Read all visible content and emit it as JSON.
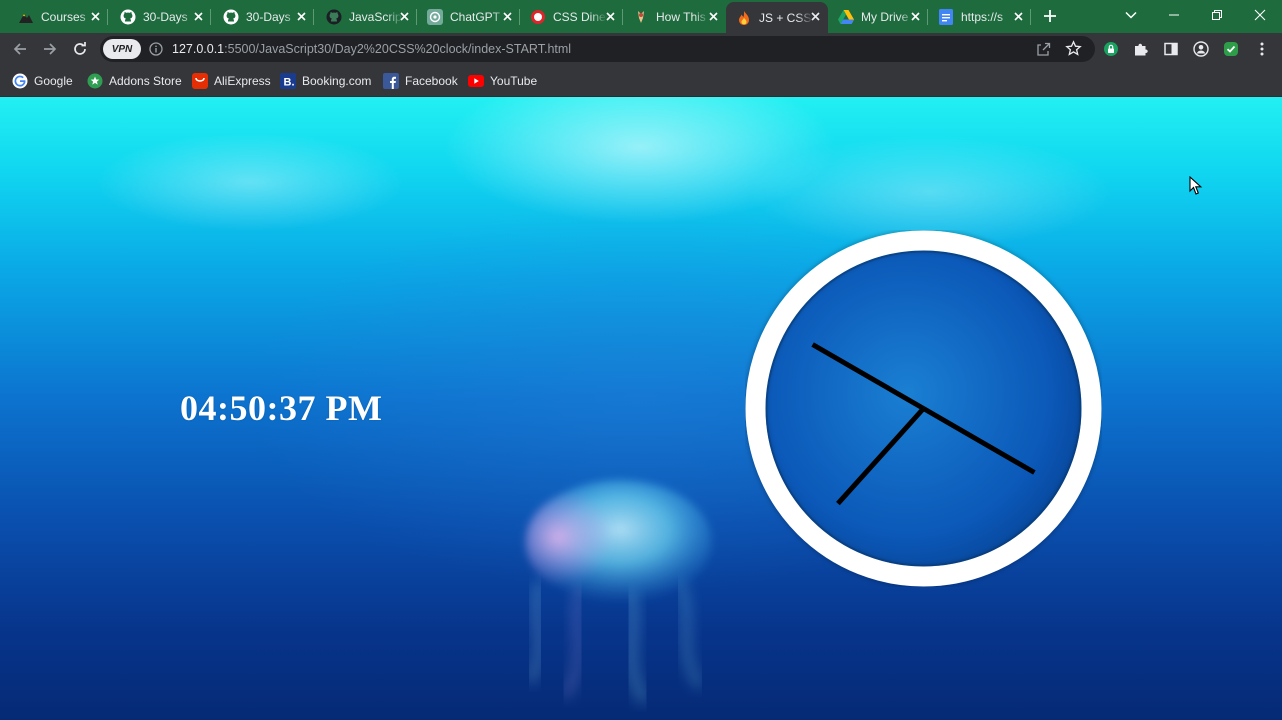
{
  "tabs": [
    {
      "title": "Courses",
      "icon": "mountain-logo-icon",
      "active": false
    },
    {
      "title": "30-Days",
      "icon": "github-icon",
      "active": false
    },
    {
      "title": "30-Days",
      "icon": "github-icon",
      "active": false
    },
    {
      "title": "JavaScript",
      "icon": "github-icon",
      "active": false
    },
    {
      "title": "ChatGPT",
      "icon": "chatgpt-icon",
      "active": false
    },
    {
      "title": "CSS Diner",
      "icon": "css-diner-icon",
      "active": false
    },
    {
      "title": "How This",
      "icon": "figure-icon",
      "active": false
    },
    {
      "title": "JS + CSS",
      "icon": "flame-icon",
      "active": true
    },
    {
      "title": "My Drive",
      "icon": "google-drive-icon",
      "active": false
    },
    {
      "title": "https://s",
      "icon": "google-docs-icon",
      "active": false
    }
  ],
  "omnibox": {
    "vpn_label": "VPN",
    "url_host": "127.0.0.1",
    "url_rest": ":5500/JavaScript30/Day2%20CSS%20clock/index-START.html"
  },
  "bookmarks": [
    {
      "label": "Google",
      "icon": "google-icon"
    },
    {
      "label": "Addons Store",
      "icon": "addons-store-icon"
    },
    {
      "label": "AliExpress",
      "icon": "aliexpress-icon"
    },
    {
      "label": "Booking.com",
      "icon": "booking-icon"
    },
    {
      "label": "Facebook",
      "icon": "facebook-icon"
    },
    {
      "label": "YouTube",
      "icon": "youtube-icon"
    }
  ],
  "page": {
    "digital_time": "04:50:37 PM",
    "clock": {
      "hours": 16,
      "minutes": 50,
      "seconds": 37
    }
  },
  "colors": {
    "tab_strip": "#1e6b3e",
    "toolbar": "#35363a",
    "clock_ring": "#ffffff",
    "clock_hands": "#000000"
  }
}
